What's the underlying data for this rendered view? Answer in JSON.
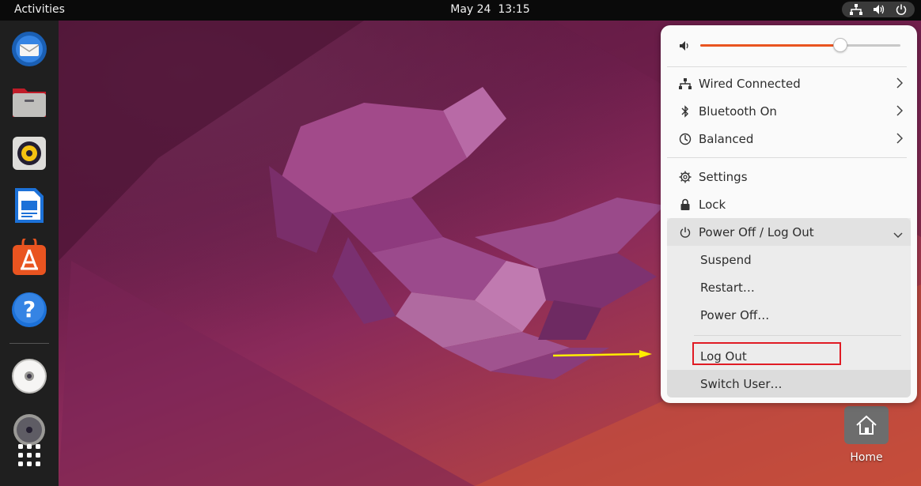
{
  "topbar": {
    "activities_label": "Activities",
    "date": "May 24",
    "time": "13:15",
    "indicators": [
      "network-icon",
      "volume-icon",
      "power-icon"
    ]
  },
  "dock": {
    "apps": [
      "thunderbird-icon",
      "files-icon",
      "rhythmbox-icon",
      "libreoffice-writer-icon",
      "app-center-icon",
      "help-icon",
      "disc-icon",
      "disc-2-icon",
      "show-apps-icon"
    ]
  },
  "system_menu": {
    "volume_level": 0.7,
    "items": [
      {
        "icon": "wired-network-icon",
        "label": "Wired Connected",
        "has_submenu": true
      },
      {
        "icon": "bluetooth-icon",
        "label": "Bluetooth On",
        "has_submenu": true
      },
      {
        "icon": "power-profile-icon",
        "label": "Balanced",
        "has_submenu": true
      }
    ],
    "settings_label": "Settings",
    "lock_label": "Lock",
    "power_menu": {
      "label": "Power Off / Log Out",
      "items": [
        "Suspend",
        "Restart…",
        "Power Off…",
        "Log Out",
        "Switch User…"
      ]
    }
  },
  "desktop": {
    "home_label": "Home"
  },
  "colors": {
    "accent": "#e95420",
    "highlight_box": "#e01b24",
    "arrow": "#ffee00"
  }
}
